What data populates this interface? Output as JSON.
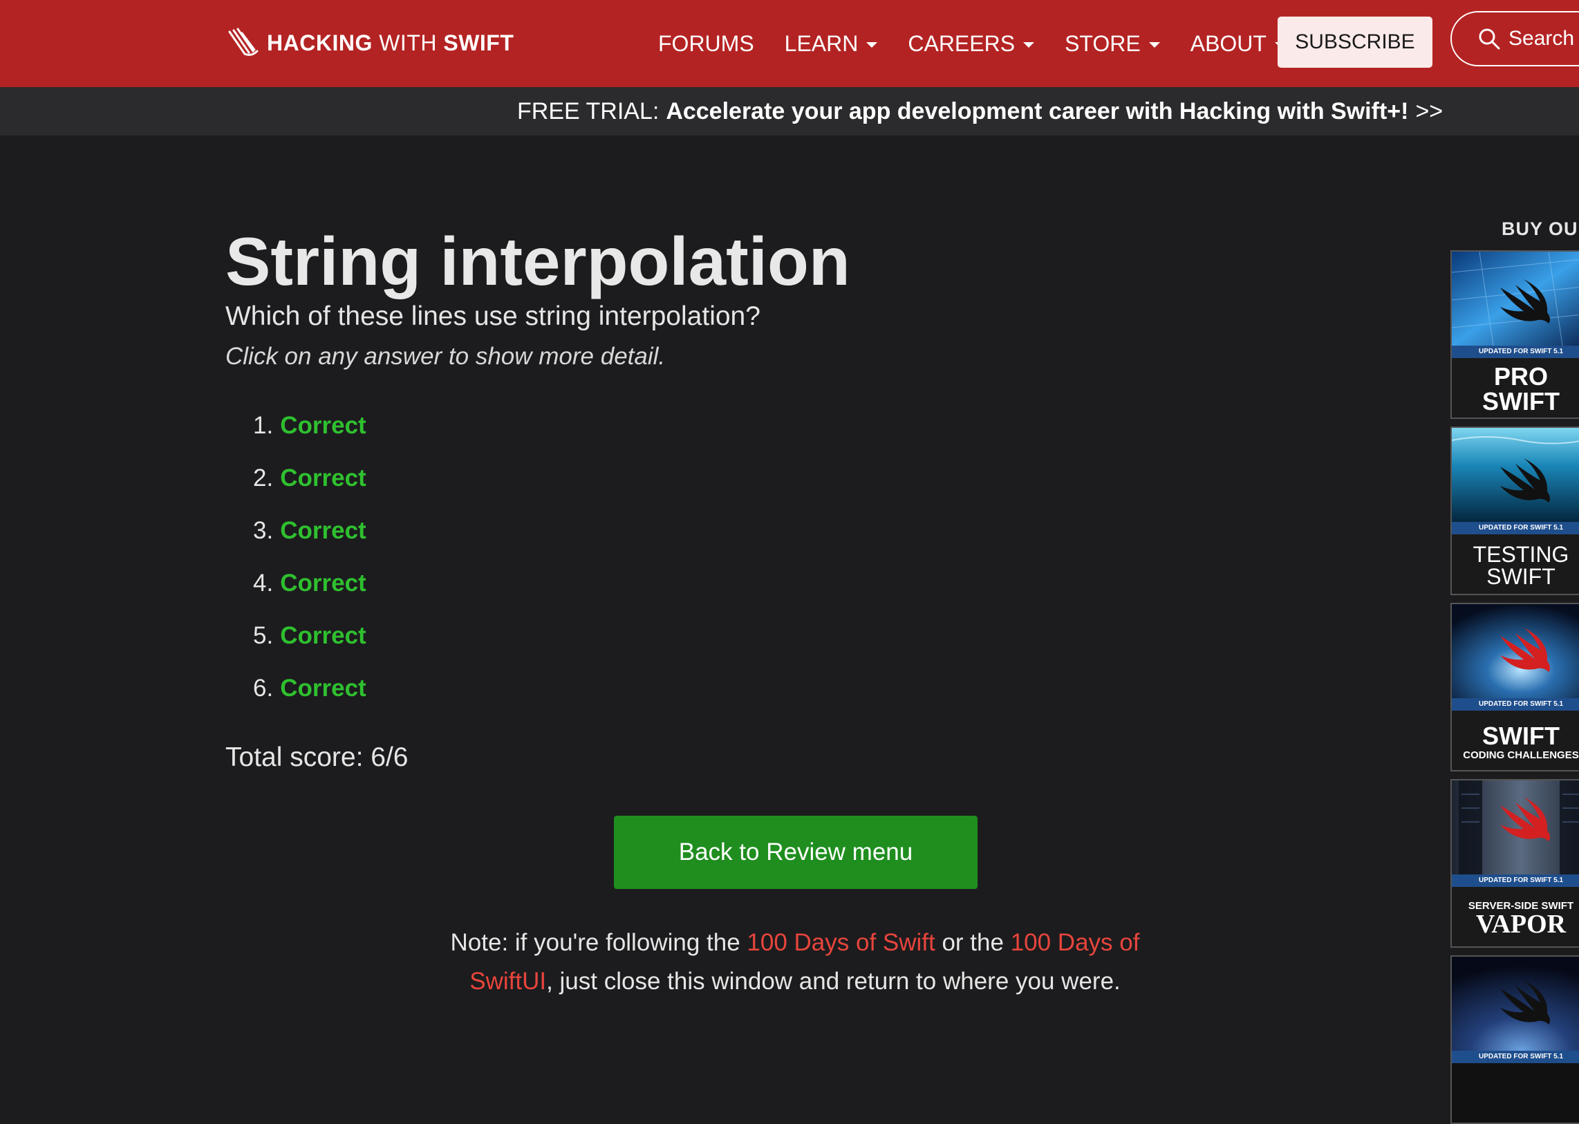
{
  "navbar": {
    "brand_bold_1": "HACKING",
    "brand_thin": "WITH",
    "brand_bold_2": "SWIFT",
    "links": [
      {
        "label": "FORUMS",
        "dropdown": false
      },
      {
        "label": "LEARN",
        "dropdown": true
      },
      {
        "label": "CAREERS",
        "dropdown": true
      },
      {
        "label": "STORE",
        "dropdown": true
      },
      {
        "label": "ABOUT",
        "dropdown": true
      }
    ],
    "subscribe_label": "SUBSCRIBE",
    "search_label": "Search",
    "background_color": "#b42323"
  },
  "promo": {
    "prefix": "FREE TRIAL:",
    "bold_text": "Accelerate your app development career with Hacking with Swift+!",
    "arrows": ">>"
  },
  "main": {
    "title": "String interpolation",
    "question": "Which of these lines use string interpolation?",
    "hint": "Click on any answer to show more detail.",
    "answers": [
      {
        "number": "1.",
        "result": "Correct"
      },
      {
        "number": "2.",
        "result": "Correct"
      },
      {
        "number": "3.",
        "result": "Correct"
      },
      {
        "number": "4.",
        "result": "Correct"
      },
      {
        "number": "5.",
        "result": "Correct"
      },
      {
        "number": "6.",
        "result": "Correct"
      }
    ],
    "score": "Total score: 6/6",
    "back_button_label": "Back to Review menu",
    "note": {
      "before": "Note: if you're following the ",
      "link1": "100 Days of Swift",
      "middle": " or the ",
      "link2": "100 Days of SwiftUI",
      "after": ", just close this window and return to where you were."
    },
    "correct_color": "#2fc02f",
    "button_color": "#1f8e1f",
    "link_color": "#e8453c"
  },
  "sidebar": {
    "heading": "BUY OU",
    "books": [
      {
        "band": "UPDATED FOR SWIFT 5.1",
        "title_line1": "PRO",
        "title_line2": "SWIFT",
        "icon": "swift-bird-icon"
      },
      {
        "band": "UPDATED FOR SWIFT 5.1",
        "title_line1": "TESTING",
        "title_line2": "SWIFT",
        "icon": "swift-bird-icon"
      },
      {
        "band": "UPDATED FOR SWIFT 5.1",
        "title_line1": "SWIFT",
        "title_line2": "CODING CHALLENGES",
        "icon": "swift-bird-icon"
      },
      {
        "band": "UPDATED FOR SWIFT 5.1",
        "title_line1": "SERVER-SIDE SWIFT",
        "title_line2": "VAPOR",
        "icon": "swift-bird-icon"
      },
      {
        "band": "UPDATED FOR SWIFT 5.1",
        "icon": "swift-bird-icon"
      }
    ]
  }
}
